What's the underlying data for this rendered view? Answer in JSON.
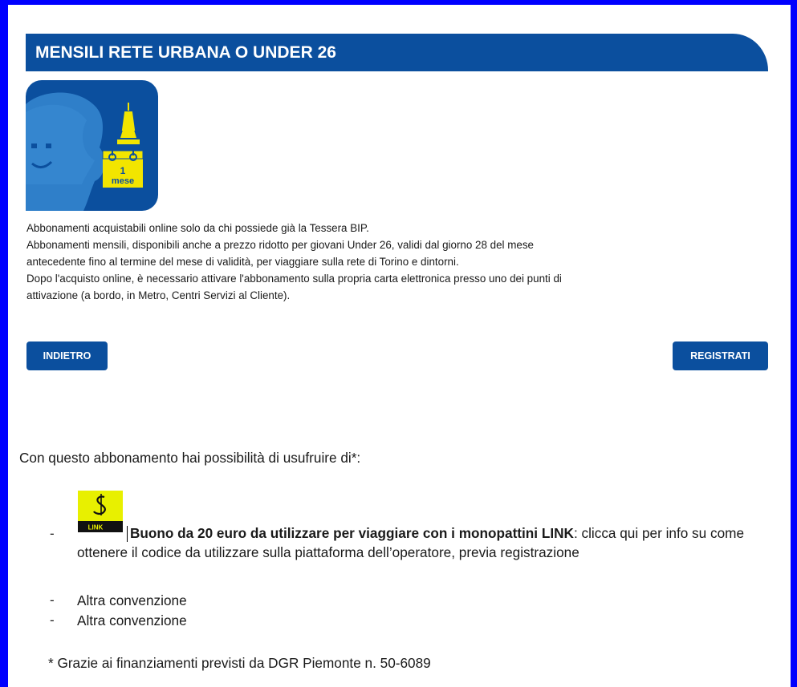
{
  "header": {
    "title": "MENSILI RETE URBANA O UNDER 26"
  },
  "logo": {
    "icon": "monthly-pass-icon",
    "calendar_number": "1",
    "calendar_word": "mese",
    "colors": {
      "background": "#0b4f9e",
      "accent": "#f2e500",
      "face": "#2f7fc9"
    }
  },
  "description": {
    "lines": [
      "Abbonamenti acquistabili online solo da chi possiede già la Tessera BIP.",
      "Abbonamenti mensili, disponibili anche a prezzo ridotto per giovani Under 26, validi dal giorno 28 del mese",
      "antecedente fino al termine del mese di validità, per viaggiare sulla rete di Torino e dintorni.",
      "Dopo l'acquisto online, è necessario attivare l'abbonamento sulla propria carta elettronica presso uno dei punti di",
      "attivazione (a bordo, in Metro, Centri Servizi al Cliente)."
    ]
  },
  "buttons": {
    "back": "INDIETRO",
    "register": "REGISTRATI"
  },
  "benefits": {
    "intro": "Con questo abbonamento hai possibilità di usufruire di*:",
    "dash": "-",
    "link_logo_text": "LINK",
    "item1_bold": "Buono da 20 euro da utilizzare per viaggiare con i monopattini LINK",
    "item1_rest": ": clicca qui per info su come ottenere il codice da utilizzare  sulla piattaforma dell’operatore, previa registrazione",
    "item2": "Altra convenzione",
    "item3": "Altra convenzione"
  },
  "footnote": "* Grazie ai finanziamenti previsti da DGR Piemonte n. 50-6089",
  "colors": {
    "brand_blue": "#0b4f9e",
    "frame_blue": "#0000ff",
    "link_yellow": "#e8f000"
  }
}
